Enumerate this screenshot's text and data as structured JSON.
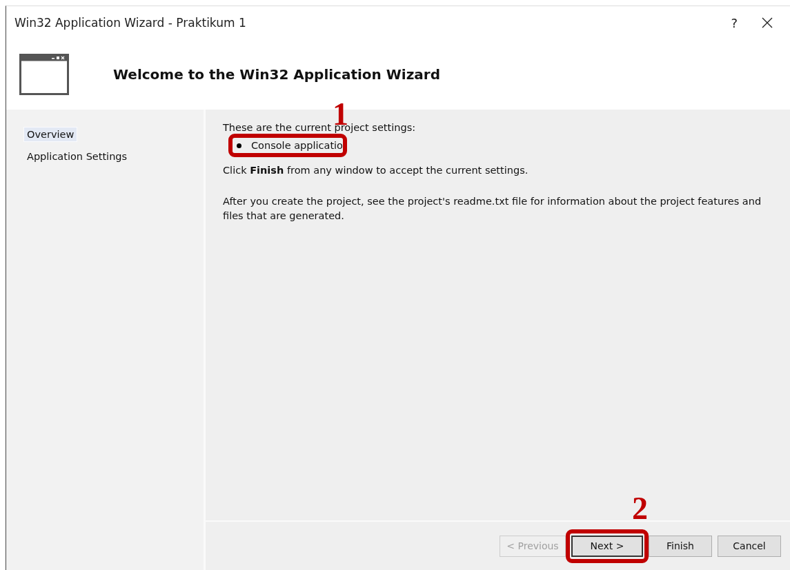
{
  "window": {
    "title": "Win32 Application Wizard - Praktikum 1",
    "help": "?"
  },
  "header": {
    "title": "Welcome to the Win32 Application Wizard"
  },
  "sidebar": {
    "items": [
      {
        "label": "Overview",
        "selected": true
      },
      {
        "label": "Application Settings",
        "selected": false
      }
    ]
  },
  "content": {
    "intro": "These are the current project settings:",
    "settings": [
      {
        "label": "Console applicatio",
        "annotation": "1"
      }
    ],
    "paragraphs": [
      "Click **Finish** from any window to accept the current settings.",
      "After you create the project, see the project's readme.txt file for information about the project features and files that are generated."
    ]
  },
  "buttons": [
    {
      "label": "< Previous",
      "disabled": true,
      "default": false
    },
    {
      "label": "Next >",
      "disabled": false,
      "default": true,
      "annotation": "2"
    },
    {
      "label": "Finish",
      "disabled": false,
      "default": false
    },
    {
      "label": "Cancel",
      "disabled": false,
      "default": false
    }
  ]
}
